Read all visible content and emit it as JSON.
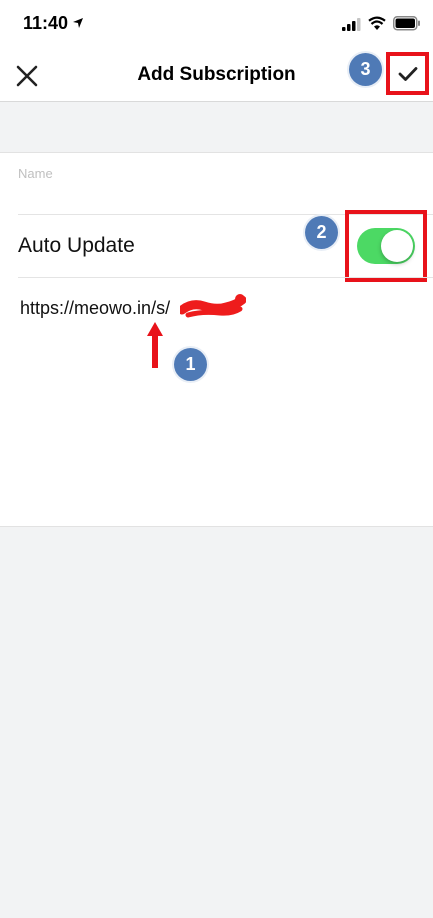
{
  "status_bar": {
    "time": "11:40",
    "icons": [
      "location-arrow-icon",
      "signal-icon",
      "wifi-icon",
      "battery-icon"
    ]
  },
  "nav": {
    "title": "Add Subscription",
    "left_icon": "close-icon",
    "right_icon": "checkmark-icon"
  },
  "form": {
    "name_label": "Name",
    "name_value": "",
    "auto_update_label": "Auto Update",
    "auto_update_enabled": true,
    "url_value": "https://meowo.in/s/"
  },
  "annotations": {
    "badge_1": "1",
    "badge_2": "2",
    "badge_3": "3",
    "highlight_color": "#e8121a",
    "badge_color": "#4f7ab6"
  },
  "colors": {
    "toggle_on": "#4cd964",
    "background": "#f2f3f4"
  }
}
